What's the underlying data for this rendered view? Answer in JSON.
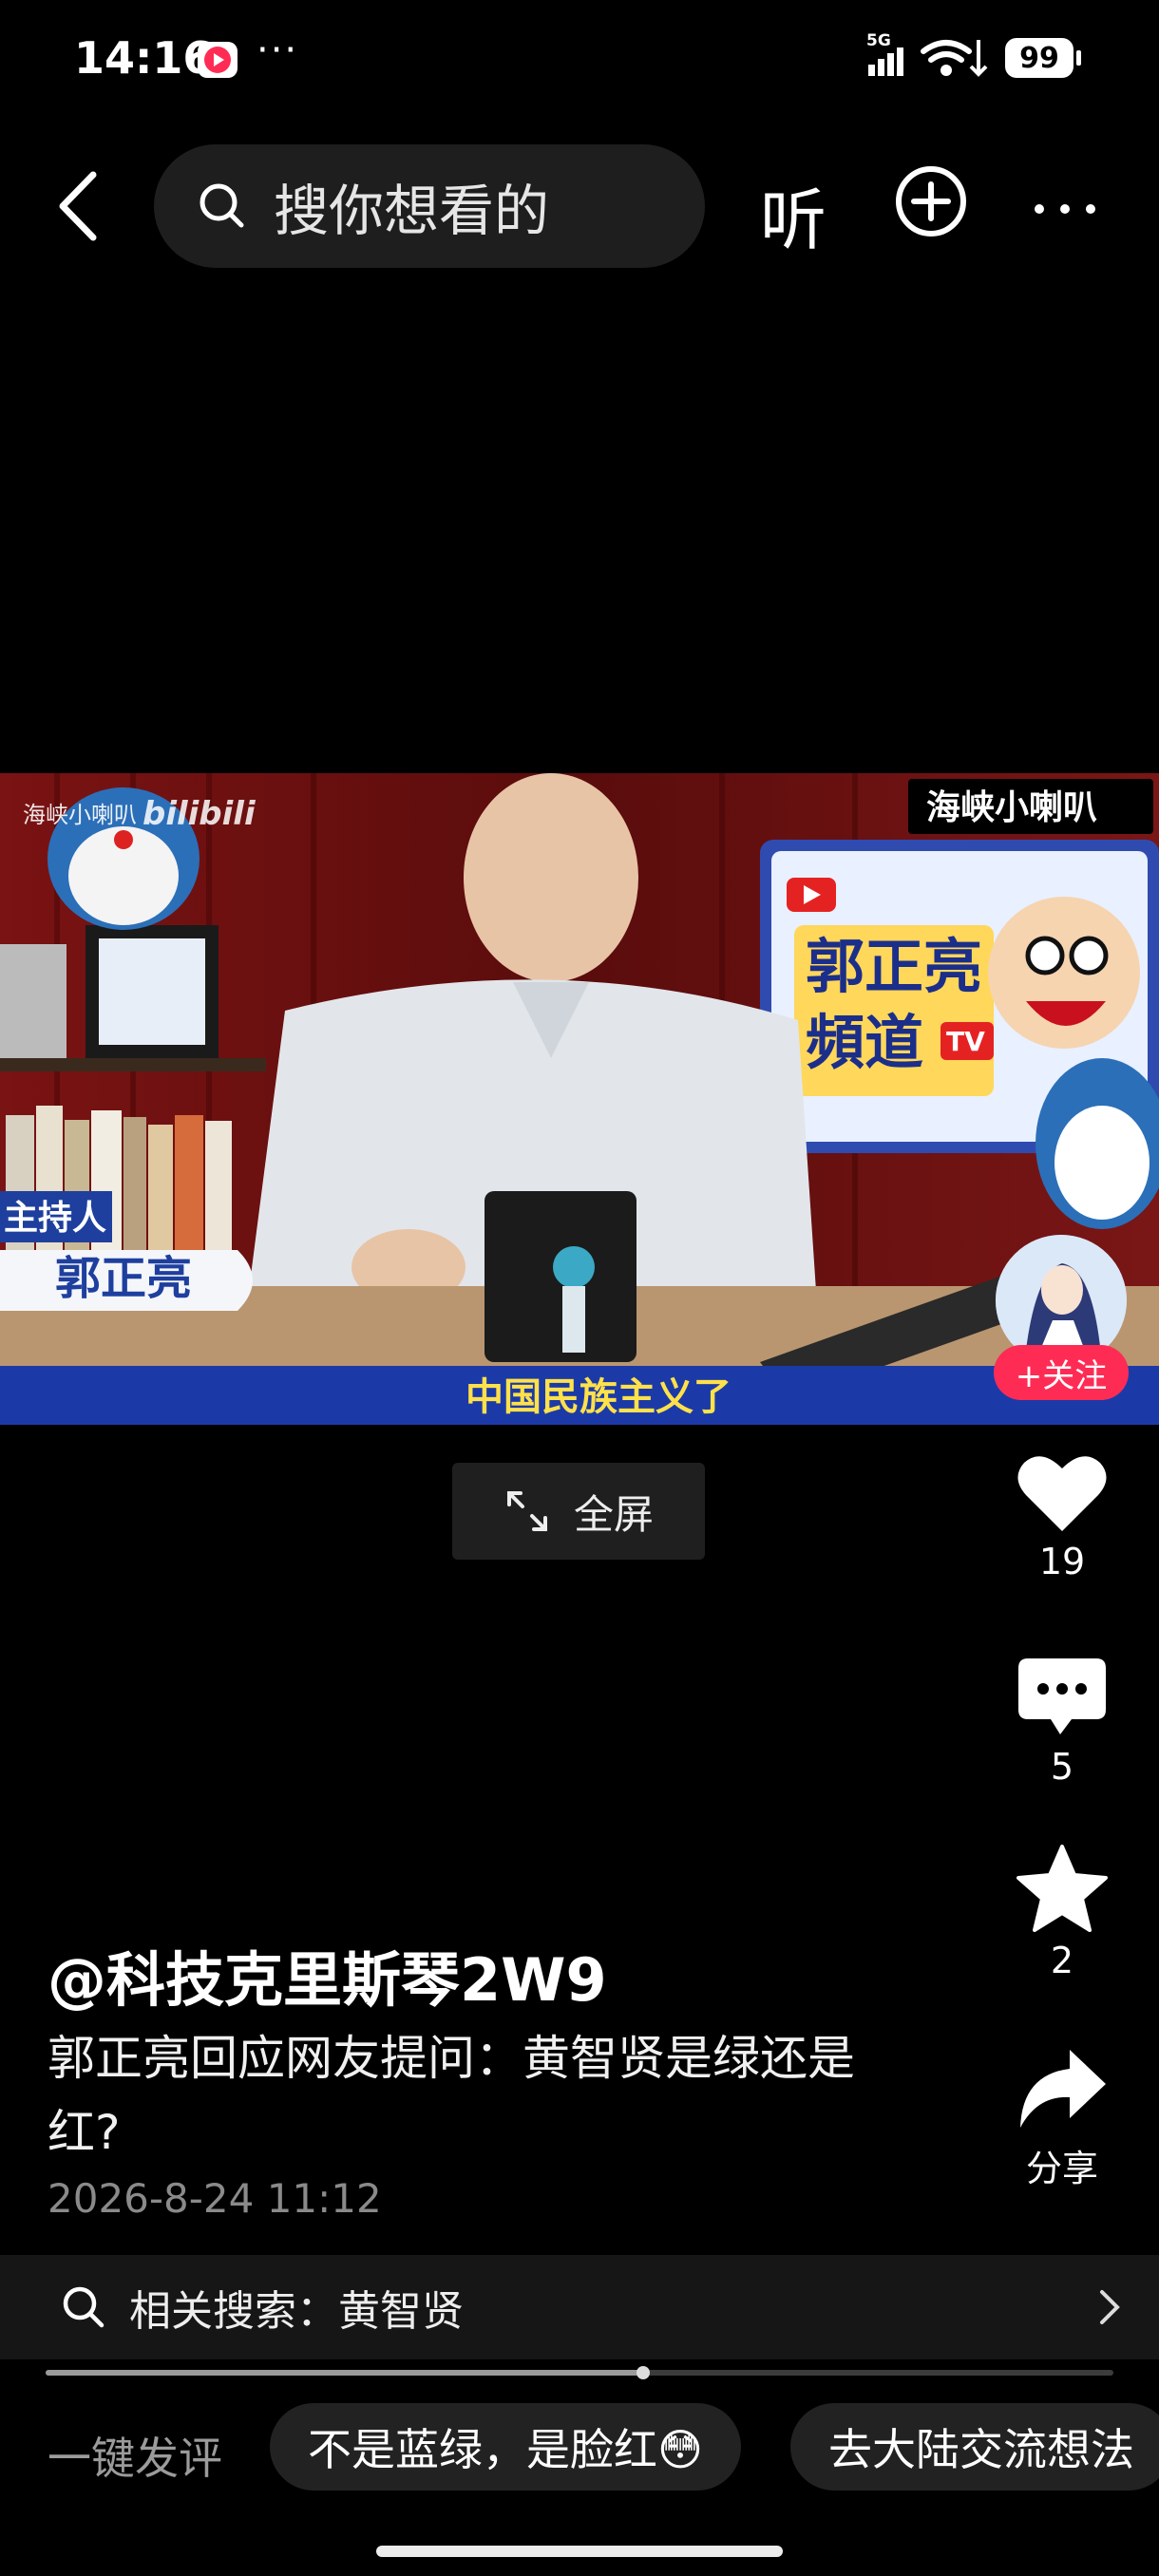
{
  "status_bar": {
    "time": "14:16",
    "more": "···",
    "network": "5G",
    "battery": "99"
  },
  "nav": {
    "search_placeholder": "搜你想看的",
    "listen_label": "听"
  },
  "video": {
    "watermark": "海峡小喇叭",
    "platform_logo": "bilibili",
    "top_right_tag": "海峡小喇叭",
    "banner_line1": "郭正亮",
    "banner_line2": "頻道",
    "banner_tv": "TV",
    "host_title": "主持人",
    "host_name": "郭正亮",
    "subtitle": "中国民族主义了"
  },
  "fullscreen_label": "全屏",
  "follow_label": "+关注",
  "actions": {
    "likes": "19",
    "comments": "5",
    "favorites": "2",
    "share_label": "分享"
  },
  "post": {
    "author": "@科技克里斯琴2W9",
    "caption": "郭正亮回应网友提问：黄智贤是绿还是红?",
    "date": "2026-8-24 11:12"
  },
  "related_search": {
    "label": "相关搜索：黄智贤"
  },
  "playback_progress": 0.56,
  "quick_comment": {
    "label": "一键发评",
    "chips": [
      "不是蓝绿，是脸红😳",
      "去大陆交流想法"
    ]
  },
  "colors": {
    "accent": "#fe2c55",
    "background": "#000000",
    "video_bg": "#6c1111"
  }
}
